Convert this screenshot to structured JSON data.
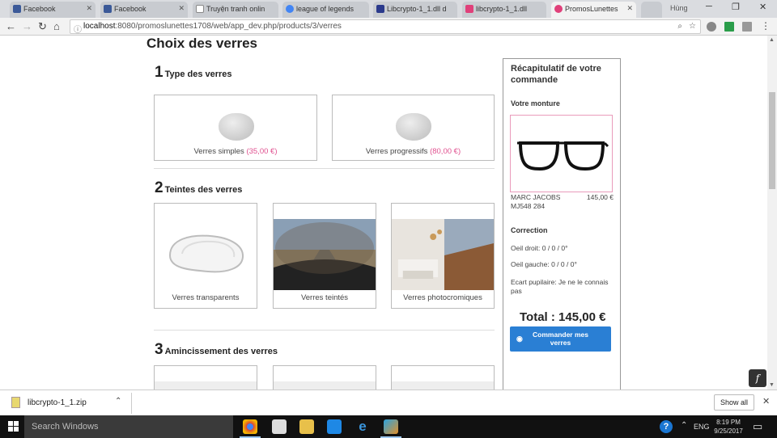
{
  "browser": {
    "tabs": [
      {
        "label": "Facebook",
        "color": "#3b5998"
      },
      {
        "label": "Facebook",
        "color": "#3b5998"
      },
      {
        "label": "Truyện tranh onlin",
        "color": "#ffffff"
      },
      {
        "label": "league of legends",
        "color": "#4285f4"
      },
      {
        "label": "Libcrypto-1_1.dll d",
        "color": "#2b3a8c"
      },
      {
        "label": "libcrypto-1_1.dll",
        "color": "#e0407a"
      },
      {
        "label": "PromosLunettes",
        "color": "#e0407a"
      }
    ],
    "user": "Hùng",
    "url": {
      "host": "localhost",
      "rest": ":8080/promoslunettes1708/web/app_dev.php/products/3/verres"
    }
  },
  "page": {
    "title": "Choix des verres",
    "sections": [
      {
        "num": "1",
        "label": "Type des verres"
      },
      {
        "num": "2",
        "label": "Teintes des verres"
      },
      {
        "num": "3",
        "label": "Amincissement des verres"
      }
    ],
    "lens_types": [
      {
        "name": "Verres simples",
        "price": "(35,00 €)"
      },
      {
        "name": "Verres progressifs",
        "price": "(80,00 €)"
      }
    ],
    "tints": [
      {
        "name": "Verres transparents"
      },
      {
        "name": "Verres teintés"
      },
      {
        "name": "Verres photocromiques"
      }
    ]
  },
  "summary": {
    "title": "Récapitulatif de votre commande",
    "frame_heading": "Votre monture",
    "frame_name_1": "MARC JACOBS",
    "frame_name_2": "MJ548 284",
    "frame_price": "145,00 €",
    "correction_heading": "Correction",
    "right_eye": "Oeil droit: 0 / 0 / 0°",
    "left_eye": "Oeil gauche: 0 / 0 / 0°",
    "pupil": "Ecart pupilaire: Je ne le connais pas",
    "total": "Total : 145,00 €",
    "order_button": "Commander mes verres"
  },
  "downloads": {
    "file": "libcrypto-1_1.zip",
    "show_all": "Show all"
  },
  "taskbar": {
    "search_placeholder": "Search Windows",
    "lang": "ENG",
    "time": "8:19 PM",
    "date": "9/25/2017"
  }
}
